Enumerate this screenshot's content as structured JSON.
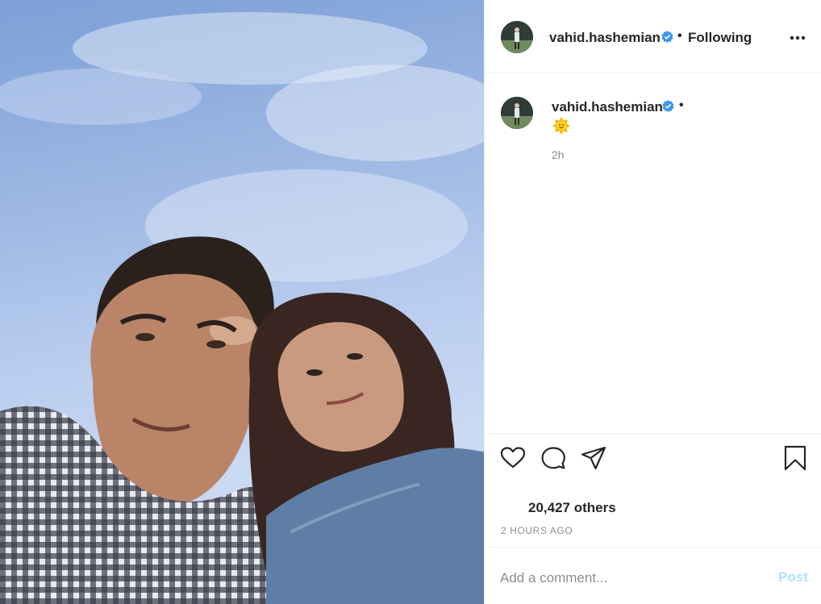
{
  "post": {
    "image_alt": "selfie-photo"
  },
  "header": {
    "username": "vahid.hashemian",
    "separator": "•",
    "follow_status": "Following"
  },
  "caption": {
    "username": "vahid.hashemian",
    "separator": "•",
    "text": "🌞",
    "time": "2h"
  },
  "actions": {
    "like": "heart-icon",
    "comment": "comment-icon",
    "share": "share-icon",
    "save": "bookmark-icon"
  },
  "stats": {
    "likes": "20,427 others",
    "age": "2 HOURS AGO"
  },
  "comment_box": {
    "placeholder": "Add a comment...",
    "post_label": "Post"
  },
  "colors": {
    "verified": "#3897f0",
    "post_disabled": "#b2dffc",
    "muted": "#8e8e8e"
  }
}
